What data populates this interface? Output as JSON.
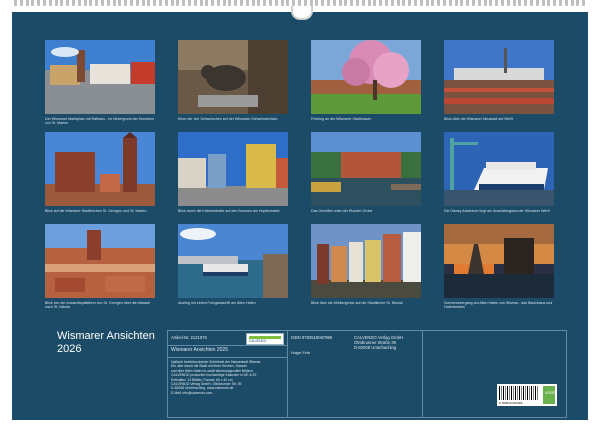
{
  "calendar": {
    "title_line1": "Wismarer Ansichten",
    "title_line2": "2026"
  },
  "photos": [
    {
      "caption": "Der Wismarer Marktplatz mit Rathaus - im Hintergrund der Kirchturm von St. Marien"
    },
    {
      "caption": "Einer der vier Schweinchen auf der Wismarer Schweinsbrücke"
    },
    {
      "caption": "Frühling an der Wismarer Stadtmauer"
    },
    {
      "caption": "Blick über die Wismarer Neustadt auf Werft"
    },
    {
      "caption": "Blick auf die Wismarer Stadtkirchen St. Georgen und St. Marien"
    },
    {
      "caption": "Blick durch die Krämerstraße auf den Brunnen am Hopfenmarkt"
    },
    {
      "caption": "Das Gewölbe unter der Runden Grube"
    },
    {
      "caption": "Die Disney Adventure liegt am Ausrüstungskai der Wismarer Werft"
    },
    {
      "caption": "Blick von der Aussichtsplattform von St. Georgen über die Altstadt nach St. Nikolai"
    },
    {
      "caption": "Ausflug mit einem Fahrgastschiff am Alten Hafen"
    },
    {
      "caption": "Blick über die Mühlengrube auf die Stadtkirche St. Nikolai"
    },
    {
      "caption": "Sonnenuntergang am Alten Hafen von Wismar - das Baumhaus und Hafenbecken"
    }
  ],
  "info": {
    "art_label": "Artikel-Nr. 2121978",
    "isbn": "ISBN 9783516067996",
    "publisher": [
      "CALVENDO Verlag GmbH",
      "Ottobrunner Straße 39",
      "D-82008 Unterhaching"
    ],
    "calendar_name": "Wismarer Ansichten 2026",
    "photographer": "Holger Felix",
    "logo_text": "CALVENDO",
    "description": "Idyllisch beeindruckende Schönheit der Hansestadt Wismar.\nEin Jahr durch die Stadt mit ihren Kirchen, Gassen\nund dem Alten Hafen in zwölf stimmungsvollen Bildern.\nCALVENDO produziert hochwertige Kalender in DE & AT.\nEnthalten: 13 Blätter, Format: 60 x 40 cm\nCALVENDO Verlag GmbH, Ottobrunner Str. 39\nD-82008 Unterhaching  www.calvendo.de\nE-Mail: info@calvendo.com",
    "barcode_number": "9 783516 067996",
    "eco_label": "GREEN"
  },
  "colors": {
    "background": "#1b4b66",
    "page": "#ffffff"
  }
}
